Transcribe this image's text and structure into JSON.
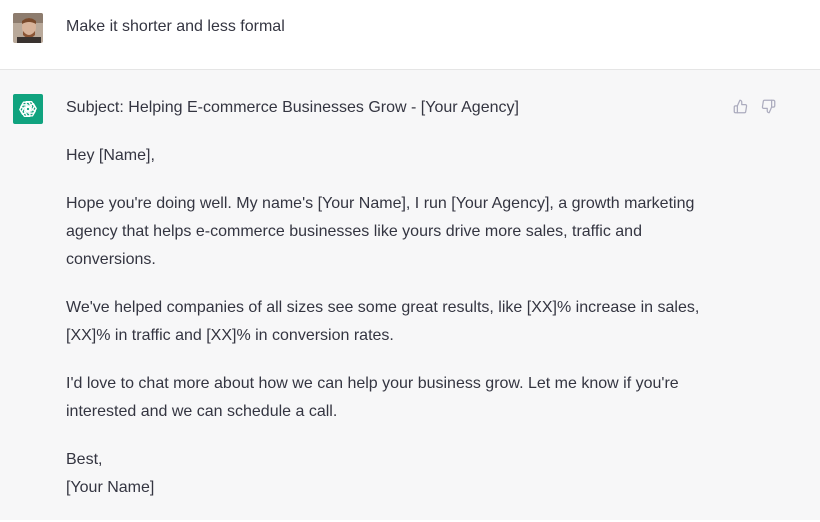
{
  "user_message": {
    "text": "Make it shorter and less formal"
  },
  "assistant_message": {
    "subject": "Subject: Helping E-commerce Businesses Grow - [Your Agency]",
    "greeting": "Hey [Name],",
    "paragraph_1_line_1": "Hope you're doing well. My name's [Your Name], I run [Your Agency], a growth marketing",
    "paragraph_1_line_2": "agency that helps e-commerce businesses like yours drive more sales, traffic and",
    "paragraph_1_line_3": "conversions.",
    "paragraph_2_line_1": "We've helped companies of all sizes see some great results, like [XX]% increase in sales,",
    "paragraph_2_line_2": "[XX]% in traffic and [XX]% in conversion rates.",
    "paragraph_3_line_1": "I'd love to chat more about how we can help your business grow. Let me know if you're",
    "paragraph_3_line_2": "interested and we can schedule a call.",
    "signoff": "Best,",
    "signature": "[Your Name]"
  },
  "icons": {
    "assistant_logo": "openai-logo-icon",
    "thumbs_up": "thumbs-up-icon",
    "thumbs_down": "thumbs-down-icon"
  },
  "colors": {
    "assistant_bg": "#f7f7f8",
    "logo_bg": "#10a37f",
    "text": "#343541"
  }
}
